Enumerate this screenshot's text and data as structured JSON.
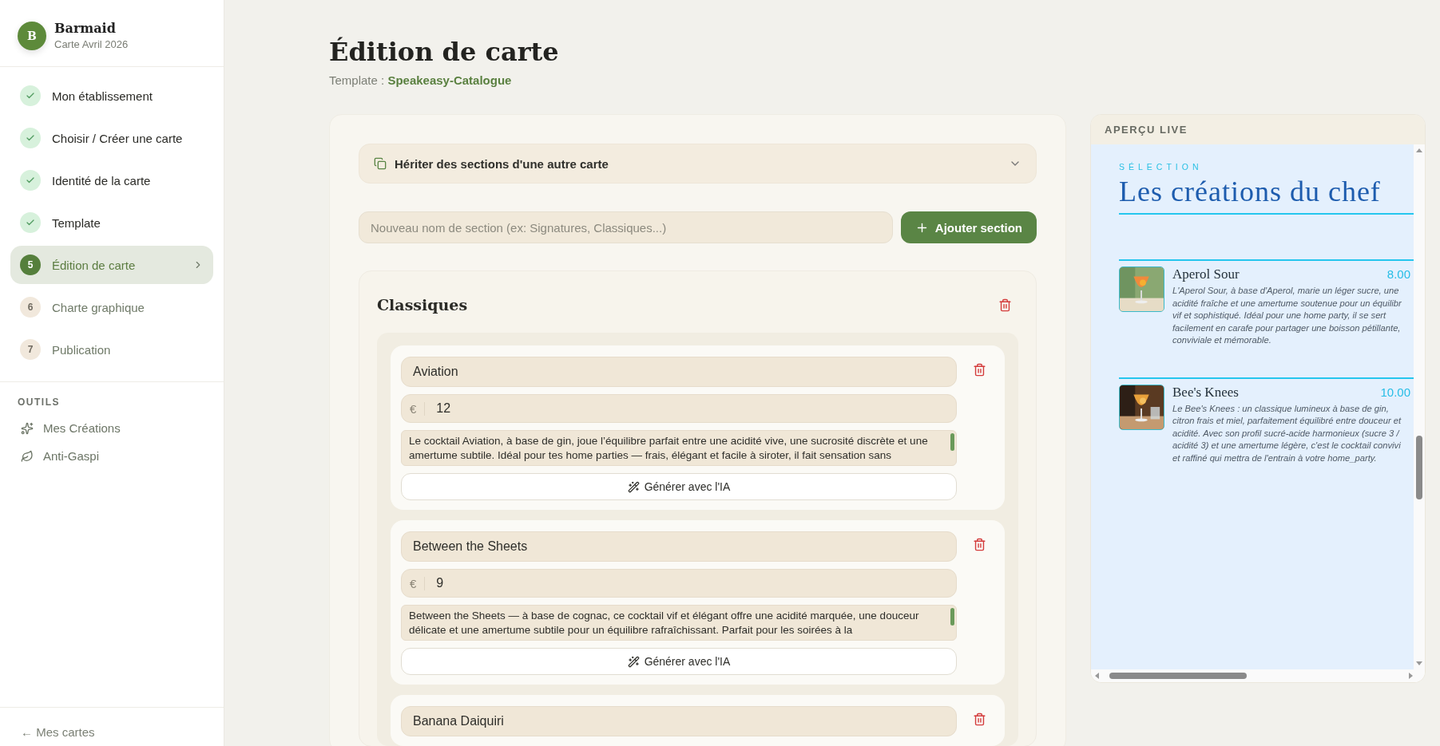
{
  "sidebar": {
    "brand": {
      "initial": "B",
      "name": "Barmaid",
      "subtitle": "Carte Avril 2026"
    },
    "steps": [
      {
        "label": "Mon établissement",
        "completed": true,
        "selected": false
      },
      {
        "label": "Choisir / Créer une carte",
        "completed": true,
        "selected": false
      },
      {
        "label": "Identité de la carte",
        "completed": true,
        "selected": false
      },
      {
        "label": "Template",
        "completed": true,
        "selected": false
      },
      {
        "label": "Édition de carte",
        "completed": false,
        "number": "5",
        "selected": true
      },
      {
        "label": "Charte graphique",
        "completed": false,
        "number": "6",
        "selected": false
      },
      {
        "label": "Publication",
        "completed": false,
        "number": "7",
        "selected": false
      }
    ],
    "tools_heading": "OUTILS",
    "tools": [
      {
        "label": "Mes Créations"
      },
      {
        "label": "Anti-Gaspi"
      }
    ],
    "back_link": "← Mes cartes"
  },
  "header": {
    "title": "Édition de carte",
    "template_label": "Template :",
    "template_name": "Speakeasy-Catalogue"
  },
  "editor": {
    "inherit_label": "Hériter des sections d'une autre carte",
    "new_section": {
      "placeholder": "Nouveau nom de section (ex: Signatures, Classiques...)"
    },
    "add_button": "Ajouter section",
    "sections": [
      {
        "title": "Classiques",
        "items": [
          {
            "name": "Aviation",
            "currency": "€",
            "price": "12",
            "description": "Le cocktail Aviation, à base de gin, joue l’équilibre parfait entre une acidité vive, une sucrosité discrète et une amertume subtile. Idéal pour tes home parties — frais, élégant et facile à siroter, il fait sensation sans",
            "generate_label": "Générer avec l'IA"
          },
          {
            "name": "Between the Sheets",
            "currency": "€",
            "price": "9",
            "description": "Between the Sheets — à base de cognac, ce cocktail vif et élégant offre une acidité marquée, une douceur délicate et une amertume subtile pour un équilibre rafraîchissant. Parfait pour les soirées à la",
            "generate_label": "Générer avec l'IA"
          },
          {
            "name": "Banana Daiquiri"
          }
        ]
      }
    ]
  },
  "preview": {
    "heading": "APERÇU LIVE",
    "eyebrow": "SÉLECTION",
    "title": "Les créations du chef",
    "items": [
      {
        "name": "Aperol Sour",
        "price": "8.00",
        "description_lines": [
          "L'Aperol Sour, à base d'Aperol, marie un léger sucre, une",
          "acidité fraîche et une amertume soutenue pour un équilibr",
          "vif et sophistiqué. Idéal pour une home party, il se sert",
          "facilement en carafe pour partager une boisson pétillante,",
          "conviviale et mémorable."
        ]
      },
      {
        "name": "Bee's Knees",
        "price": "10.00",
        "description_lines": [
          "Le Bee's Knees : un classique lumineux à base de gin,",
          "citron frais et miel, parfaitement équilibré entre douceur et",
          "acidité. Avec son profil sucré-acide harmonieux (sucre 3 /",
          "acidité 3) et une amertume légère, c'est le cocktail convivi",
          "et raffiné qui mettra de l'entrain à votre home_party."
        ]
      }
    ]
  }
}
